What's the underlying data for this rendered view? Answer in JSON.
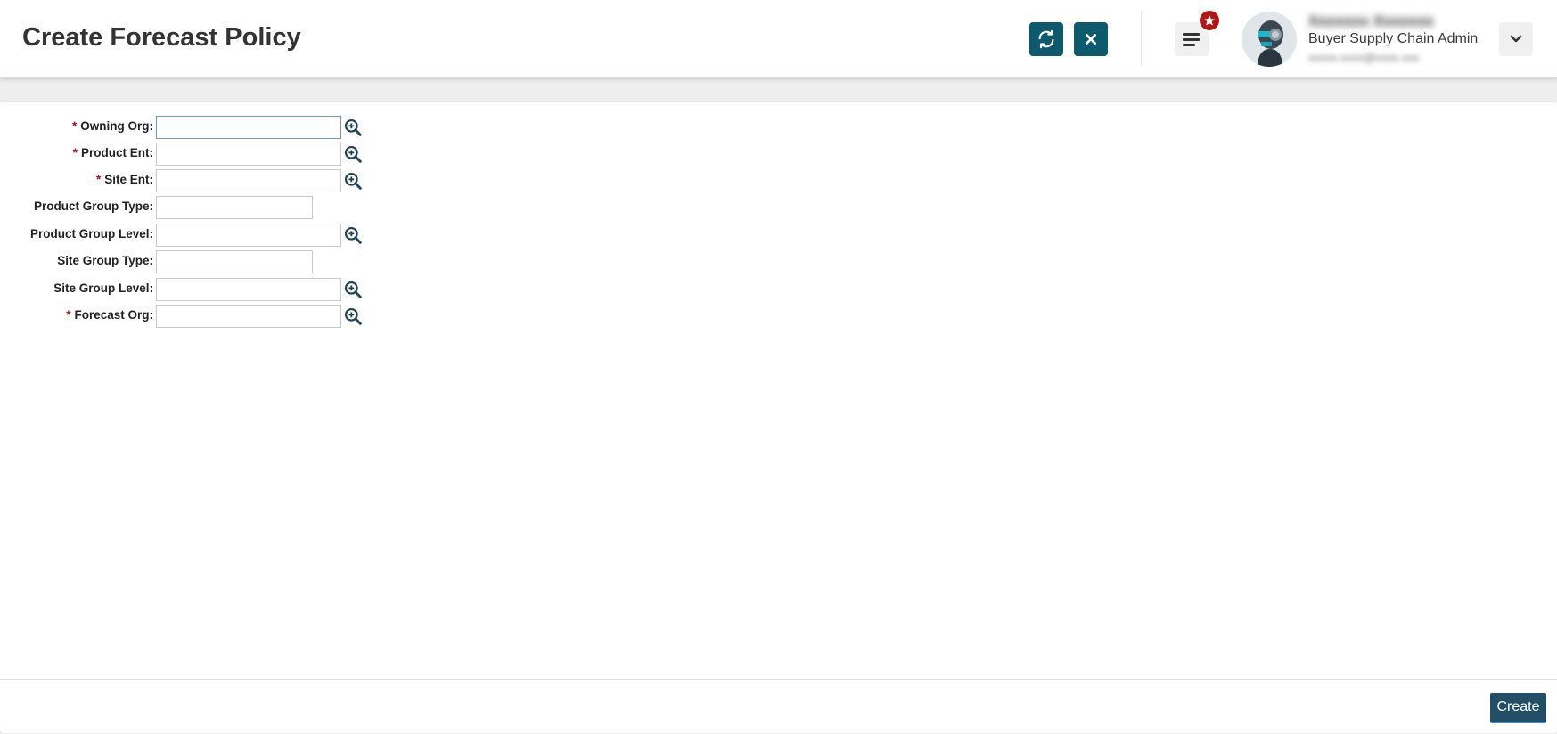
{
  "header": {
    "title": "Create Forecast Policy",
    "refresh_icon": "refresh-icon",
    "close_icon": "close-icon",
    "menu_icon": "hamburger-menu-icon",
    "badge_icon": "star-icon",
    "user": {
      "name": "Xxxxxxx Xxxxxxx",
      "role": "Buyer Supply Chain Admin",
      "email": "xxxxx.xxxx@xxxx.xxx"
    },
    "dropdown_icon": "chevron-down-icon"
  },
  "form": {
    "fields": [
      {
        "label": "Owning Org:",
        "required": "*",
        "value": "",
        "lookup": true
      },
      {
        "label": "Product Ent:",
        "required": "*",
        "value": "",
        "lookup": true
      },
      {
        "label": "Site Ent:",
        "required": "*",
        "value": "",
        "lookup": true
      },
      {
        "label": "Product Group Type:",
        "required": "",
        "value": "",
        "lookup": false
      },
      {
        "label": "Product Group Level:",
        "required": "",
        "value": "",
        "lookup": true
      },
      {
        "label": "Site Group Type:",
        "required": "",
        "value": "",
        "lookup": false
      },
      {
        "label": "Site Group Level:",
        "required": "",
        "value": "",
        "lookup": true
      },
      {
        "label": "Forecast Org:",
        "required": "*",
        "value": "",
        "lookup": true
      }
    ]
  },
  "footer": {
    "create_label": "Create"
  },
  "colors": {
    "primary": "#0d5a6e",
    "create_button": "#244e66",
    "badge": "#b01818",
    "required": "#a01515"
  }
}
